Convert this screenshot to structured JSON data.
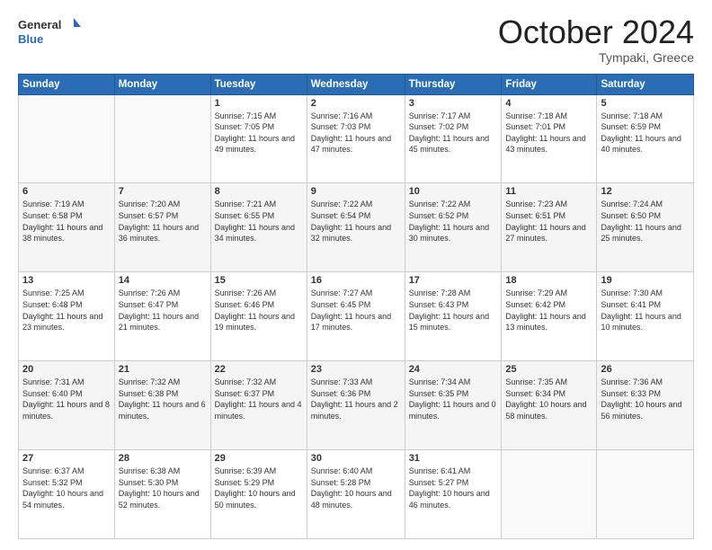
{
  "header": {
    "logo_general": "General",
    "logo_blue": "Blue",
    "month": "October 2024",
    "location": "Tympaki, Greece"
  },
  "days_of_week": [
    "Sunday",
    "Monday",
    "Tuesday",
    "Wednesday",
    "Thursday",
    "Friday",
    "Saturday"
  ],
  "weeks": [
    [
      {
        "day": "",
        "info": ""
      },
      {
        "day": "",
        "info": ""
      },
      {
        "day": "1",
        "info": "Sunrise: 7:15 AM\nSunset: 7:05 PM\nDaylight: 11 hours and 49 minutes."
      },
      {
        "day": "2",
        "info": "Sunrise: 7:16 AM\nSunset: 7:03 PM\nDaylight: 11 hours and 47 minutes."
      },
      {
        "day": "3",
        "info": "Sunrise: 7:17 AM\nSunset: 7:02 PM\nDaylight: 11 hours and 45 minutes."
      },
      {
        "day": "4",
        "info": "Sunrise: 7:18 AM\nSunset: 7:01 PM\nDaylight: 11 hours and 43 minutes."
      },
      {
        "day": "5",
        "info": "Sunrise: 7:18 AM\nSunset: 6:59 PM\nDaylight: 11 hours and 40 minutes."
      }
    ],
    [
      {
        "day": "6",
        "info": "Sunrise: 7:19 AM\nSunset: 6:58 PM\nDaylight: 11 hours and 38 minutes."
      },
      {
        "day": "7",
        "info": "Sunrise: 7:20 AM\nSunset: 6:57 PM\nDaylight: 11 hours and 36 minutes."
      },
      {
        "day": "8",
        "info": "Sunrise: 7:21 AM\nSunset: 6:55 PM\nDaylight: 11 hours and 34 minutes."
      },
      {
        "day": "9",
        "info": "Sunrise: 7:22 AM\nSunset: 6:54 PM\nDaylight: 11 hours and 32 minutes."
      },
      {
        "day": "10",
        "info": "Sunrise: 7:22 AM\nSunset: 6:52 PM\nDaylight: 11 hours and 30 minutes."
      },
      {
        "day": "11",
        "info": "Sunrise: 7:23 AM\nSunset: 6:51 PM\nDaylight: 11 hours and 27 minutes."
      },
      {
        "day": "12",
        "info": "Sunrise: 7:24 AM\nSunset: 6:50 PM\nDaylight: 11 hours and 25 minutes."
      }
    ],
    [
      {
        "day": "13",
        "info": "Sunrise: 7:25 AM\nSunset: 6:48 PM\nDaylight: 11 hours and 23 minutes."
      },
      {
        "day": "14",
        "info": "Sunrise: 7:26 AM\nSunset: 6:47 PM\nDaylight: 11 hours and 21 minutes."
      },
      {
        "day": "15",
        "info": "Sunrise: 7:26 AM\nSunset: 6:46 PM\nDaylight: 11 hours and 19 minutes."
      },
      {
        "day": "16",
        "info": "Sunrise: 7:27 AM\nSunset: 6:45 PM\nDaylight: 11 hours and 17 minutes."
      },
      {
        "day": "17",
        "info": "Sunrise: 7:28 AM\nSunset: 6:43 PM\nDaylight: 11 hours and 15 minutes."
      },
      {
        "day": "18",
        "info": "Sunrise: 7:29 AM\nSunset: 6:42 PM\nDaylight: 11 hours and 13 minutes."
      },
      {
        "day": "19",
        "info": "Sunrise: 7:30 AM\nSunset: 6:41 PM\nDaylight: 11 hours and 10 minutes."
      }
    ],
    [
      {
        "day": "20",
        "info": "Sunrise: 7:31 AM\nSunset: 6:40 PM\nDaylight: 11 hours and 8 minutes."
      },
      {
        "day": "21",
        "info": "Sunrise: 7:32 AM\nSunset: 6:38 PM\nDaylight: 11 hours and 6 minutes."
      },
      {
        "day": "22",
        "info": "Sunrise: 7:32 AM\nSunset: 6:37 PM\nDaylight: 11 hours and 4 minutes."
      },
      {
        "day": "23",
        "info": "Sunrise: 7:33 AM\nSunset: 6:36 PM\nDaylight: 11 hours and 2 minutes."
      },
      {
        "day": "24",
        "info": "Sunrise: 7:34 AM\nSunset: 6:35 PM\nDaylight: 11 hours and 0 minutes."
      },
      {
        "day": "25",
        "info": "Sunrise: 7:35 AM\nSunset: 6:34 PM\nDaylight: 10 hours and 58 minutes."
      },
      {
        "day": "26",
        "info": "Sunrise: 7:36 AM\nSunset: 6:33 PM\nDaylight: 10 hours and 56 minutes."
      }
    ],
    [
      {
        "day": "27",
        "info": "Sunrise: 6:37 AM\nSunset: 5:32 PM\nDaylight: 10 hours and 54 minutes."
      },
      {
        "day": "28",
        "info": "Sunrise: 6:38 AM\nSunset: 5:30 PM\nDaylight: 10 hours and 52 minutes."
      },
      {
        "day": "29",
        "info": "Sunrise: 6:39 AM\nSunset: 5:29 PM\nDaylight: 10 hours and 50 minutes."
      },
      {
        "day": "30",
        "info": "Sunrise: 6:40 AM\nSunset: 5:28 PM\nDaylight: 10 hours and 48 minutes."
      },
      {
        "day": "31",
        "info": "Sunrise: 6:41 AM\nSunset: 5:27 PM\nDaylight: 10 hours and 46 minutes."
      },
      {
        "day": "",
        "info": ""
      },
      {
        "day": "",
        "info": ""
      }
    ]
  ]
}
